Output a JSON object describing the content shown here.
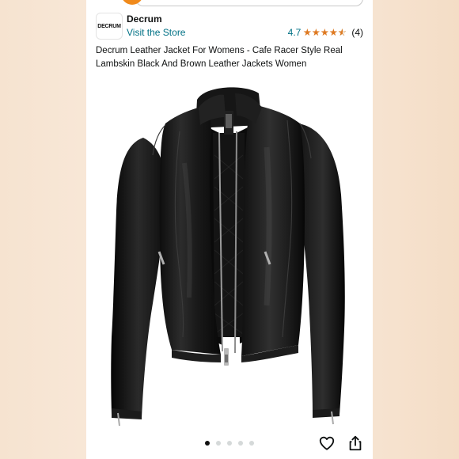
{
  "store": {
    "logo_text": "DECRUM",
    "name": "Decrum",
    "visit_link": "Visit the Store"
  },
  "rating": {
    "score": "4.7",
    "stars": 4.7,
    "count": "(4)",
    "star_color": "#de7921"
  },
  "product": {
    "title": "Decrum Leather Jacket For Womens - Cafe Racer Style Real Lambskin Black And Brown Leather Jackets Women"
  },
  "gallery": {
    "image_count": 5,
    "active_index": 0
  },
  "icons": {
    "favorite": "heart-icon",
    "share": "share-icon"
  },
  "colors": {
    "link": "#007185",
    "text": "#0f1111",
    "camera_button": "#f08a1c"
  }
}
